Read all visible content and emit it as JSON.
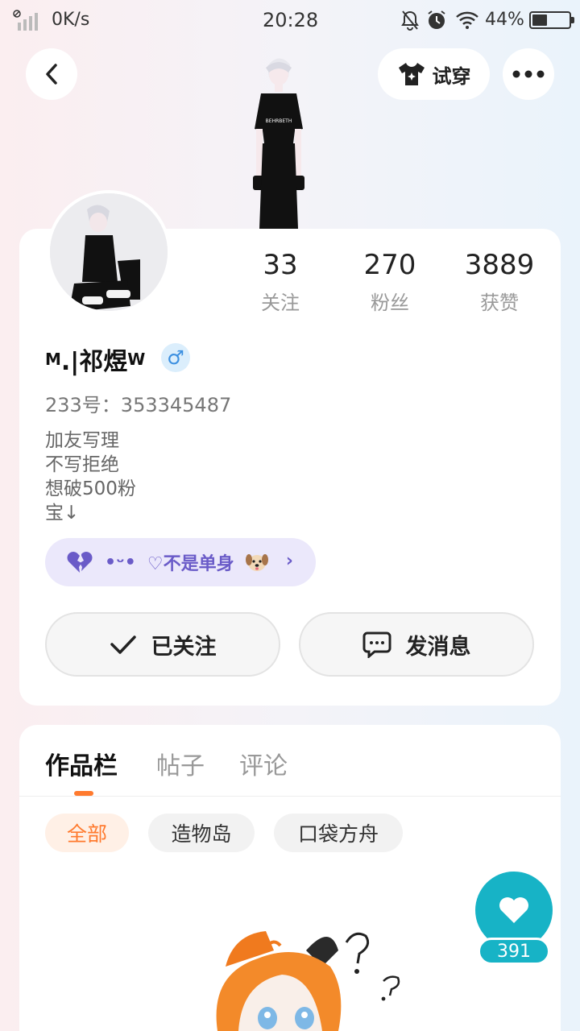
{
  "status_bar": {
    "net_speed": "0K/s",
    "time": "20:28",
    "battery_pct": "44%"
  },
  "header": {
    "try_on_label": "试穿"
  },
  "profile": {
    "stats": [
      {
        "value": "33",
        "label": "关注"
      },
      {
        "value": "270",
        "label": "粉丝"
      },
      {
        "value": "3889",
        "label": "获赞"
      }
    ],
    "name_prefix": "M",
    "name_main": ".|祁煜",
    "name_suffix": "W",
    "gender_symbol": "♂",
    "user_id": "233号：353345487",
    "bio": [
      "加友写理",
      "不写拒绝",
      "想破500粉",
      "宝↓"
    ],
    "relation": {
      "face": "•ᵕ•",
      "text": "♡不是单身"
    },
    "follow_label": "已关注",
    "message_label": "发消息"
  },
  "tabs": [
    "作品栏",
    "帖子",
    "评论"
  ],
  "filters": [
    "全部",
    "造物岛",
    "口袋方舟"
  ],
  "like_count": "391",
  "colors": {
    "accent": "#ff7a2e",
    "like": "#17b3c6",
    "relation_bg": "#ebe8fb",
    "relation_text": "#6a5bc8"
  }
}
